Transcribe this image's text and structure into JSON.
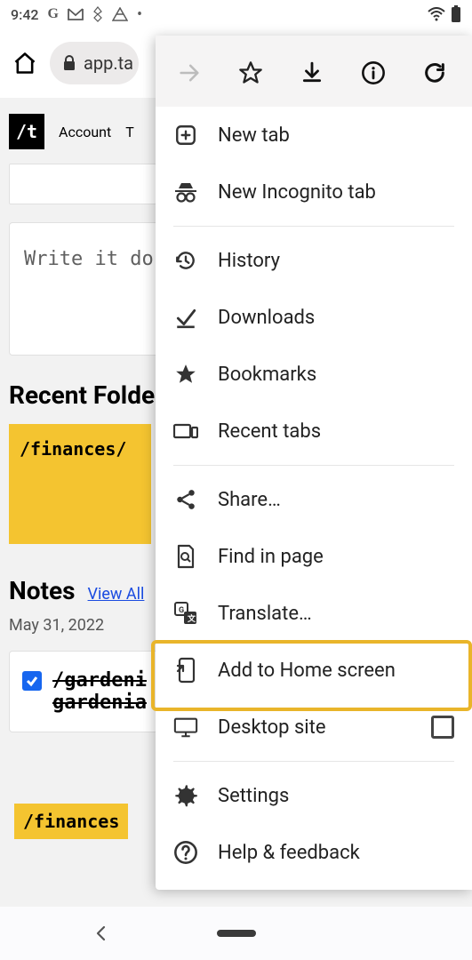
{
  "status": {
    "time": "9:42"
  },
  "browser": {
    "url": "app.ta"
  },
  "app": {
    "nav1": "Account",
    "nav2_partial": "T"
  },
  "note_preview": "Write it do",
  "recent_folders_title": "Recent Folders",
  "folder1": "/finances/",
  "notes": {
    "title": "Notes",
    "view_all": "View All",
    "date": "May 31, 2022",
    "item1_line1": "/gardeni",
    "item1_line2": "gardenia",
    "folder_partial": "/finances"
  },
  "menu": {
    "new_tab": "New tab",
    "incognito": "New Incognito tab",
    "history": "History",
    "downloads": "Downloads",
    "bookmarks": "Bookmarks",
    "recent_tabs": "Recent tabs",
    "share": "Share…",
    "find": "Find in page",
    "translate": "Translate…",
    "add_home": "Add to Home screen",
    "desktop": "Desktop site",
    "settings": "Settings",
    "help": "Help & feedback"
  }
}
